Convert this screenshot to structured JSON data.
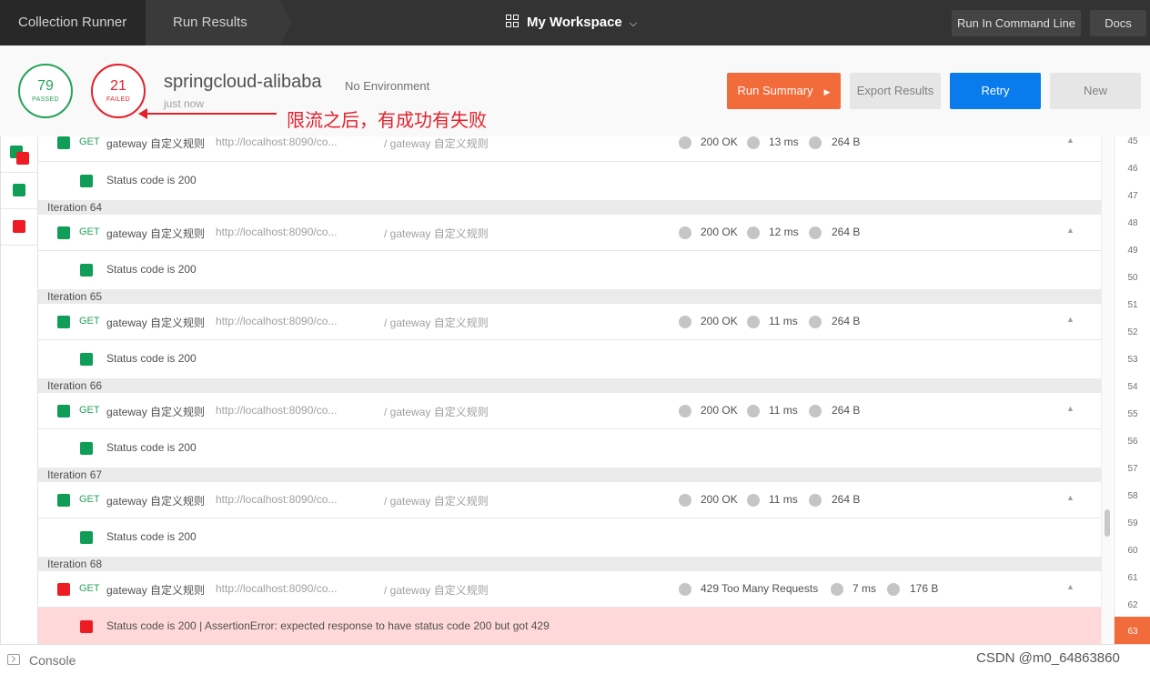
{
  "topbar": {
    "crumb1": "Collection Runner",
    "crumb2": "Run Results",
    "workspace": "My Workspace",
    "run_cli": "Run In Command Line",
    "docs": "Docs"
  },
  "summary": {
    "passed_count": "79",
    "passed_label": "PASSED",
    "failed_count": "21",
    "failed_label": "FAILED",
    "collection_name": "springcloud-alibaba",
    "environment": "No Environment",
    "time": "just now",
    "annotation": "限流之后，有成功有失败",
    "passed_color": "#26a35a",
    "failed_color": "#e5202b"
  },
  "buttons": {
    "run_summary": "Run Summary",
    "export": "Export Results",
    "retry": "Retry",
    "new": "New"
  },
  "iterations": [
    {
      "label": "",
      "status": "pass",
      "method": "GET",
      "name": "gateway 自定义规则",
      "url": "http://localhost:8090/co...",
      "path": "/ gateway 自定义规则",
      "code": "200 OK",
      "time": "13 ms",
      "size": "264 B",
      "assertion": "Status code is 200"
    },
    {
      "label": "Iteration 64",
      "status": "pass",
      "method": "GET",
      "name": "gateway 自定义规则",
      "url": "http://localhost:8090/co...",
      "path": "/ gateway 自定义规则",
      "code": "200 OK",
      "time": "12 ms",
      "size": "264 B",
      "assertion": "Status code is 200"
    },
    {
      "label": "Iteration 65",
      "status": "pass",
      "method": "GET",
      "name": "gateway 自定义规则",
      "url": "http://localhost:8090/co...",
      "path": "/ gateway 自定义规则",
      "code": "200 OK",
      "time": "11 ms",
      "size": "264 B",
      "assertion": "Status code is 200"
    },
    {
      "label": "Iteration 66",
      "status": "pass",
      "method": "GET",
      "name": "gateway 自定义规则",
      "url": "http://localhost:8090/co...",
      "path": "/ gateway 自定义规则",
      "code": "200 OK",
      "time": "11 ms",
      "size": "264 B",
      "assertion": "Status code is 200"
    },
    {
      "label": "Iteration 67",
      "status": "pass",
      "method": "GET",
      "name": "gateway 自定义规则",
      "url": "http://localhost:8090/co...",
      "path": "/ gateway 自定义规则",
      "code": "200 OK",
      "time": "11 ms",
      "size": "264 B",
      "assertion": "Status code is 200"
    },
    {
      "label": "Iteration 68",
      "status": "fail",
      "method": "GET",
      "name": "gateway 自定义规则",
      "url": "http://localhost:8090/co...",
      "path": "/ gateway 自定义规则",
      "code": "429 Too Many Requests",
      "time": "7 ms",
      "size": "176 B",
      "assertion": "Status code is 200 | AssertionError: expected response to have status code 200 but got 429"
    }
  ],
  "iteration_strip": [
    "45",
    "46",
    "47",
    "48",
    "49",
    "50",
    "51",
    "52",
    "53",
    "54",
    "55",
    "56",
    "57",
    "58",
    "59",
    "60",
    "61",
    "62",
    "63"
  ],
  "active_iteration": "63",
  "footer": {
    "console": "Console",
    "watermark": "CSDN @m0_64863860"
  }
}
